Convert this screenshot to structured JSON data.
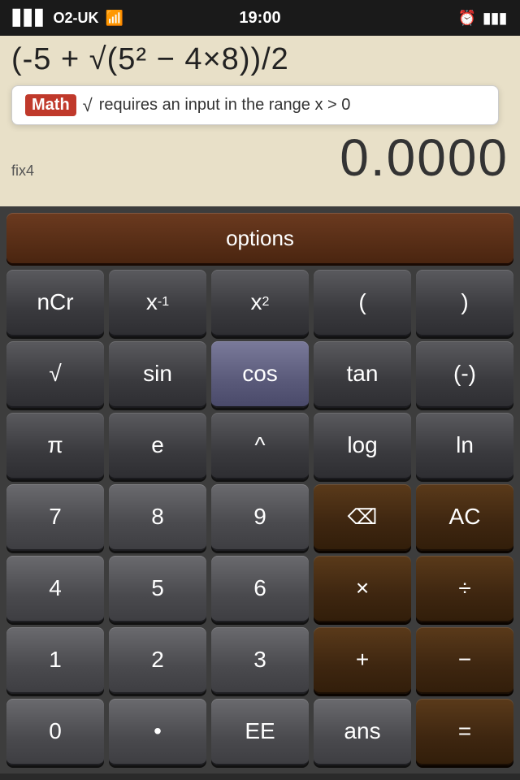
{
  "statusBar": {
    "carrier": "O2-UK",
    "time": "19:00",
    "signalIcon": "▋▋▋",
    "wifiIcon": "wifi",
    "batteryIcon": "🔋"
  },
  "display": {
    "expression": "(-5 + √(5² − 4×8))/2",
    "result": "0.0000",
    "fixLabel": "fix4",
    "error": {
      "badge": "Math",
      "symbol": "√",
      "message": " requires an input in the range x > 0"
    }
  },
  "keyboard": {
    "optionsLabel": "options",
    "rows": [
      [
        "nCr",
        "x⁻¹",
        "x²",
        "(",
        ")"
      ],
      [
        "√",
        "sin",
        "cos",
        "tan",
        "(-)"
      ],
      [
        "π",
        "e",
        "^",
        "log",
        "ln"
      ],
      [
        "7",
        "8",
        "9",
        "⌫",
        "AC"
      ],
      [
        "4",
        "5",
        "6",
        "×",
        "÷"
      ],
      [
        "1",
        "2",
        "3",
        "+",
        "−"
      ],
      [
        "0",
        "•",
        "EE",
        "ans",
        "="
      ]
    ]
  }
}
